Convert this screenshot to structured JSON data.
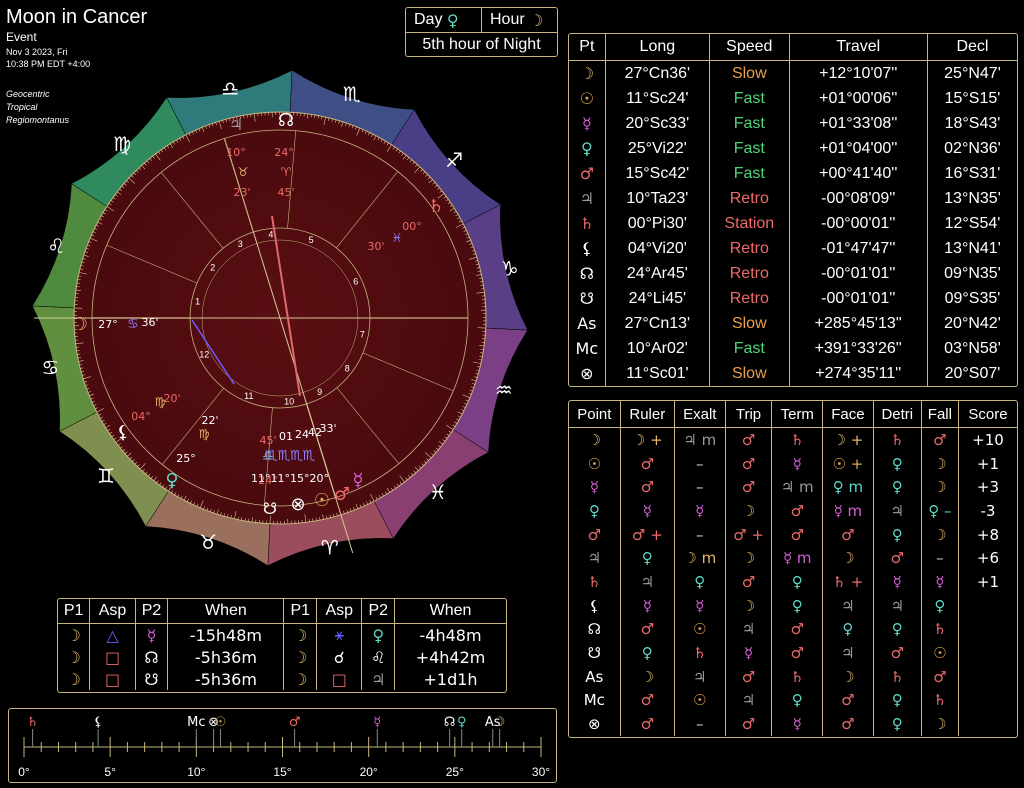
{
  "header": {
    "title": "Moon in Cancer",
    "subtitle": "Event",
    "date": "Nov 3 2023, Fri",
    "time": "10:38 PM EDT +4:00",
    "settings": [
      "Geocentric",
      "Tropical",
      "Regiomontanus"
    ]
  },
  "dayhour": {
    "day_label": "Day",
    "day_glyph": "♀",
    "hour_label": "Hour",
    "hour_glyph": "☽",
    "hour_text": "5th hour of Night"
  },
  "colors": {
    "moon": "#e9b76a",
    "sun": "#e0a64e",
    "mercury": "#d95fd8",
    "venus": "#5fd6c6",
    "mars": "#ef6a6a",
    "saturn": "#ef6a6a",
    "jupiter": "#9a9a9a",
    "fast": "#4fd37a",
    "slow": "#e9a04d",
    "retro": "#ef6a6a",
    "station": "#ef6a6a",
    "gold": "#c7b37f"
  },
  "planets": {
    "headers": [
      "Pt",
      "Long",
      "Speed",
      "Travel",
      "Decl"
    ],
    "rows": [
      {
        "g": "☽",
        "c": "#e9b76a",
        "long": "27°Cn36'",
        "speed": "Slow",
        "sc": "#e9a04d",
        "travel": "+12°10'07''",
        "decl": "25°N47'"
      },
      {
        "g": "☉",
        "c": "#e0a64e",
        "long": "11°Sc24'",
        "speed": "Fast",
        "sc": "#4fd37a",
        "travel": "+01°00'06''",
        "decl": "15°S15'"
      },
      {
        "g": "☿",
        "c": "#d95fd8",
        "long": "20°Sc33'",
        "speed": "Fast",
        "sc": "#4fd37a",
        "travel": "+01°33'08''",
        "decl": "18°S43'"
      },
      {
        "g": "♀",
        "c": "#5fd6c6",
        "long": "25°Vi22'",
        "speed": "Fast",
        "sc": "#4fd37a",
        "travel": "+01°04'00''",
        "decl": "02°N36'"
      },
      {
        "g": "♂",
        "c": "#ef6a6a",
        "long": "15°Sc42'",
        "speed": "Fast",
        "sc": "#4fd37a",
        "travel": "+00°41'40''",
        "decl": "16°S31'"
      },
      {
        "g": "♃",
        "c": "#9a9a9a",
        "long": "10°Ta23'",
        "speed": "Retro",
        "sc": "#ef6a6a",
        "travel": "-00°08'09''",
        "decl": "13°N35'"
      },
      {
        "g": "♄",
        "c": "#ef6a6a",
        "long": "00°Pi30'",
        "speed": "Station",
        "sc": "#ef6a6a",
        "travel": "-00°00'01''",
        "decl": "12°S54'"
      },
      {
        "g": "⚸",
        "c": "#ffffff",
        "long": "04°Vi20'",
        "speed": "Retro",
        "sc": "#ef6a6a",
        "travel": "-01°47'47''",
        "decl": "13°N41'"
      },
      {
        "g": "☊",
        "c": "#ffffff",
        "long": "24°Ar45'",
        "speed": "Retro",
        "sc": "#ef6a6a",
        "travel": "-00°01'01''",
        "decl": "09°N35'"
      },
      {
        "g": "☋",
        "c": "#ffffff",
        "long": "24°Li45'",
        "speed": "Retro",
        "sc": "#ef6a6a",
        "travel": "-00°01'01''",
        "decl": "09°S35'"
      },
      {
        "g": "As",
        "c": "#ffffff",
        "long": "27°Cn13'",
        "speed": "Slow",
        "sc": "#e9a04d",
        "travel": "+285°45'13''",
        "decl": "20°N42'"
      },
      {
        "g": "Mc",
        "c": "#ffffff",
        "long": "10°Ar02'",
        "speed": "Fast",
        "sc": "#4fd37a",
        "travel": "+391°33'26''",
        "decl": "03°N58'"
      },
      {
        "g": "⊗",
        "c": "#ffffff",
        "long": "11°Sc01'",
        "speed": "Slow",
        "sc": "#e9a04d",
        "travel": "+274°35'11''",
        "decl": "20°S07'"
      }
    ]
  },
  "dignities": {
    "headers": [
      "Point",
      "Ruler",
      "Exalt",
      "Trip",
      "Term",
      "Face",
      "Detri",
      "Fall",
      "Score"
    ],
    "rows": [
      [
        [
          "☽",
          "#e9b76a"
        ],
        [
          "☽ +",
          "#e9b76a"
        ],
        [
          "♃ m",
          "#9a9a9a"
        ],
        [
          "♂",
          "#ef6a6a"
        ],
        [
          "♄",
          "#ef6a6a"
        ],
        [
          "☽ +",
          "#e9b76a"
        ],
        [
          "♄",
          "#ef6a6a"
        ],
        [
          "♂",
          "#ef6a6a"
        ],
        [
          "+10",
          "#ffffff"
        ]
      ],
      [
        [
          "☉",
          "#e0a64e"
        ],
        [
          "♂",
          "#ef6a6a"
        ],
        [
          "–",
          "#cccccc"
        ],
        [
          "♂",
          "#ef6a6a"
        ],
        [
          "☿",
          "#d95fd8"
        ],
        [
          "☉ +",
          "#e0a64e"
        ],
        [
          "♀",
          "#5fd6c6"
        ],
        [
          "☽",
          "#e9b76a"
        ],
        [
          "+1",
          "#ffffff"
        ]
      ],
      [
        [
          "☿",
          "#d95fd8"
        ],
        [
          "♂",
          "#ef6a6a"
        ],
        [
          "–",
          "#cccccc"
        ],
        [
          "♂",
          "#ef6a6a"
        ],
        [
          "♃ m",
          "#9a9a9a"
        ],
        [
          "♀ m",
          "#5fd6c6"
        ],
        [
          "♀",
          "#5fd6c6"
        ],
        [
          "☽",
          "#e9b76a"
        ],
        [
          "+3",
          "#ffffff"
        ]
      ],
      [
        [
          "♀",
          "#5fd6c6"
        ],
        [
          "☿",
          "#d95fd8"
        ],
        [
          "☿",
          "#d95fd8"
        ],
        [
          "☽",
          "#e9b76a"
        ],
        [
          "♂",
          "#ef6a6a"
        ],
        [
          "☿ m",
          "#d95fd8"
        ],
        [
          "♃",
          "#9a9a9a"
        ],
        [
          "♀ –",
          "#5fd6c6"
        ],
        [
          "-3",
          "#ffffff"
        ]
      ],
      [
        [
          "♂",
          "#ef6a6a"
        ],
        [
          "♂ +",
          "#ef6a6a"
        ],
        [
          "–",
          "#cccccc"
        ],
        [
          "♂ +",
          "#ef6a6a"
        ],
        [
          "♂",
          "#ef6a6a"
        ],
        [
          "♂",
          "#ef6a6a"
        ],
        [
          "♀",
          "#5fd6c6"
        ],
        [
          "☽",
          "#e9b76a"
        ],
        [
          "+8",
          "#ffffff"
        ]
      ],
      [
        [
          "♃",
          "#9a9a9a"
        ],
        [
          "♀",
          "#5fd6c6"
        ],
        [
          "☽ m",
          "#e9b76a"
        ],
        [
          "☽",
          "#e9b76a"
        ],
        [
          "☿ m",
          "#d95fd8"
        ],
        [
          "☽",
          "#e9b76a"
        ],
        [
          "♂",
          "#ef6a6a"
        ],
        [
          "–",
          "#cccccc"
        ],
        [
          "+6",
          "#ffffff"
        ]
      ],
      [
        [
          "♄",
          "#ef6a6a"
        ],
        [
          "♃",
          "#9a9a9a"
        ],
        [
          "♀",
          "#5fd6c6"
        ],
        [
          "♂",
          "#ef6a6a"
        ],
        [
          "♀",
          "#5fd6c6"
        ],
        [
          "♄ +",
          "#ef6a6a"
        ],
        [
          "☿",
          "#d95fd8"
        ],
        [
          "☿",
          "#d95fd8"
        ],
        [
          "+1",
          "#ffffff"
        ]
      ],
      [
        [
          "⚸",
          "#ffffff"
        ],
        [
          "☿",
          "#d95fd8"
        ],
        [
          "☿",
          "#d95fd8"
        ],
        [
          "☽",
          "#e9b76a"
        ],
        [
          "♀",
          "#5fd6c6"
        ],
        [
          "♃",
          "#9a9a9a"
        ],
        [
          "♃",
          "#9a9a9a"
        ],
        [
          "♀",
          "#5fd6c6"
        ],
        [
          "",
          "#ffffff"
        ]
      ],
      [
        [
          "☊",
          "#ffffff"
        ],
        [
          "♂",
          "#ef6a6a"
        ],
        [
          "☉",
          "#e0a64e"
        ],
        [
          "♃",
          "#9a9a9a"
        ],
        [
          "♂",
          "#ef6a6a"
        ],
        [
          "♀",
          "#5fd6c6"
        ],
        [
          "♀",
          "#5fd6c6"
        ],
        [
          "♄",
          "#ef6a6a"
        ],
        [
          "",
          "#ffffff"
        ]
      ],
      [
        [
          "☋",
          "#ffffff"
        ],
        [
          "♀",
          "#5fd6c6"
        ],
        [
          "♄",
          "#ef6a6a"
        ],
        [
          "☿",
          "#d95fd8"
        ],
        [
          "♂",
          "#ef6a6a"
        ],
        [
          "♃",
          "#9a9a9a"
        ],
        [
          "♂",
          "#ef6a6a"
        ],
        [
          "☉",
          "#e0a64e"
        ],
        [
          "",
          "#ffffff"
        ]
      ],
      [
        [
          "As",
          "#ffffff"
        ],
        [
          "☽",
          "#e9b76a"
        ],
        [
          "♃",
          "#9a9a9a"
        ],
        [
          "♂",
          "#ef6a6a"
        ],
        [
          "♄",
          "#ef6a6a"
        ],
        [
          "☽",
          "#e9b76a"
        ],
        [
          "♄",
          "#ef6a6a"
        ],
        [
          "♂",
          "#ef6a6a"
        ],
        [
          "",
          "#ffffff"
        ]
      ],
      [
        [
          "Mc",
          "#ffffff"
        ],
        [
          "♂",
          "#ef6a6a"
        ],
        [
          "☉",
          "#e0a64e"
        ],
        [
          "♃",
          "#9a9a9a"
        ],
        [
          "♀",
          "#5fd6c6"
        ],
        [
          "♂",
          "#ef6a6a"
        ],
        [
          "♀",
          "#5fd6c6"
        ],
        [
          "♄",
          "#ef6a6a"
        ],
        [
          "",
          "#ffffff"
        ]
      ],
      [
        [
          "⊗",
          "#ffffff"
        ],
        [
          "♂",
          "#ef6a6a"
        ],
        [
          "–",
          "#cccccc"
        ],
        [
          "♂",
          "#ef6a6a"
        ],
        [
          "☿",
          "#d95fd8"
        ],
        [
          "♂",
          "#ef6a6a"
        ],
        [
          "♀",
          "#5fd6c6"
        ],
        [
          "☽",
          "#e9b76a"
        ],
        [
          "",
          "#ffffff"
        ]
      ]
    ]
  },
  "aspects": {
    "headers": [
      "P1",
      "Asp",
      "P2",
      "When",
      "P1",
      "Asp",
      "P2",
      "When"
    ],
    "rows": [
      [
        [
          "☽",
          "#e9b76a"
        ],
        [
          "△",
          "#6a5cff"
        ],
        [
          "☿",
          "#d95fd8"
        ],
        [
          "-15h48m",
          "#ffffff"
        ],
        [
          "☽",
          "#e9b76a"
        ],
        [
          "⚹",
          "#6a5cff"
        ],
        [
          "♀",
          "#5fd6c6"
        ],
        [
          "-4h48m",
          "#ffffff"
        ]
      ],
      [
        [
          "☽",
          "#e9b76a"
        ],
        [
          "□",
          "#ef6a6a"
        ],
        [
          "☊",
          "#ffffff"
        ],
        [
          "-5h36m",
          "#ffffff"
        ],
        [
          "☽",
          "#e9b76a"
        ],
        [
          "☌",
          "#ffffff"
        ],
        [
          "♌",
          "#ffffff"
        ],
        [
          "+4h42m",
          "#ffffff"
        ]
      ],
      [
        [
          "☽",
          "#e9b76a"
        ],
        [
          "□",
          "#ef6a6a"
        ],
        [
          "☋",
          "#ffffff"
        ],
        [
          "-5h36m",
          "#ffffff"
        ],
        [
          "☽",
          "#e9b76a"
        ],
        [
          "□",
          "#ef6a6a"
        ],
        [
          "♃",
          "#9a9a9a"
        ],
        [
          "+1d1h",
          "#ffffff"
        ]
      ]
    ]
  },
  "timeline": {
    "ticks": [
      "0°",
      "5°",
      "10°",
      "15°",
      "20°",
      "25°",
      "30°"
    ],
    "points": [
      {
        "g": "♄",
        "c": "#ef6a6a",
        "deg": 0.5
      },
      {
        "g": "⚸",
        "c": "#ffffff",
        "deg": 4.3
      },
      {
        "g": "Mc",
        "c": "#ffffff",
        "deg": 10.0
      },
      {
        "g": "⊗",
        "c": "#ffffff",
        "deg": 11.0
      },
      {
        "g": "☉",
        "c": "#e0a64e",
        "deg": 11.4
      },
      {
        "g": "♂",
        "c": "#ef6a6a",
        "deg": 15.7
      },
      {
        "g": "☿",
        "c": "#d95fd8",
        "deg": 20.5
      },
      {
        "g": "☊",
        "c": "#ffffff",
        "deg": 24.7
      },
      {
        "g": "♀",
        "c": "#5fd6c6",
        "deg": 25.4
      },
      {
        "g": "As",
        "c": "#ffffff",
        "deg": 27.2
      },
      {
        "g": "☽",
        "c": "#e9b76a",
        "deg": 27.6
      }
    ]
  },
  "wheel": {
    "signs": [
      {
        "g": "♉",
        "c": "#9b6f5e"
      },
      {
        "g": "♈",
        "c": "#9b4d5e"
      },
      {
        "g": "♓",
        "c": "#8a3f73"
      },
      {
        "g": "♒",
        "c": "#7b3f86"
      },
      {
        "g": "♑",
        "c": "#5b3f86"
      },
      {
        "g": "♐",
        "c": "#4a3f86"
      },
      {
        "g": "♏",
        "c": "#3f4f86"
      },
      {
        "g": "♎",
        "c": "#2f7a7a"
      },
      {
        "g": "♍",
        "c": "#2f8a5e"
      },
      {
        "g": "♌",
        "c": "#4f8a3f"
      },
      {
        "g": "♋",
        "c": "#5f8f3f"
      },
      {
        "g": "♊",
        "c": "#7f8f4f"
      }
    ],
    "houses": [
      "1",
      "2",
      "3",
      "4",
      "5",
      "6",
      "7",
      "8",
      "9",
      "10",
      "11",
      "12"
    ],
    "chart_labels": [
      {
        "t": "♃",
        "c": "#9a9a9a"
      },
      {
        "t": "☊",
        "c": "#ffffff"
      },
      {
        "t": "10°",
        "c": "#ef6a6a"
      },
      {
        "t": "24°",
        "c": "#ef6a6a"
      },
      {
        "t": "♉",
        "c": "#e9b76a"
      },
      {
        "t": "♈",
        "c": "#ef6a6a"
      },
      {
        "t": "23'",
        "c": "#ef6a6a"
      },
      {
        "t": "45'",
        "c": "#ef6a6a"
      },
      {
        "t": "♄",
        "c": "#ef6a6a"
      },
      {
        "t": "00°",
        "c": "#ef6a6a"
      },
      {
        "t": "♓",
        "c": "#8a7fff"
      },
      {
        "t": "30'",
        "c": "#ef6a6a"
      },
      {
        "t": "☽",
        "c": "#e9b76a"
      },
      {
        "t": "27°",
        "c": "#ffffff"
      },
      {
        "t": "♋",
        "c": "#8a7fff"
      },
      {
        "t": "36'",
        "c": "#ffffff"
      },
      {
        "t": "⚸",
        "c": "#ffffff"
      },
      {
        "t": "04°",
        "c": "#ef6a6a"
      },
      {
        "t": "♍",
        "c": "#e9b76a"
      },
      {
        "t": "20'",
        "c": "#ef6a6a"
      },
      {
        "t": "♀",
        "c": "#5fd6c6"
      },
      {
        "t": "25°",
        "c": "#ffffff"
      },
      {
        "t": "♍",
        "c": "#e9b76a"
      },
      {
        "t": "22'",
        "c": "#ffffff"
      },
      {
        "t": "45'",
        "c": "#ef6a6a"
      },
      {
        "t": "♎",
        "c": "#5fd6c6"
      },
      {
        "t": "24°",
        "c": "#ef6a6a"
      },
      {
        "t": "☋",
        "c": "#ffffff"
      },
      {
        "t": "01",
        "c": "#ffffff"
      },
      {
        "t": "24",
        "c": "#ffffff"
      },
      {
        "t": "42",
        "c": "#ffffff"
      },
      {
        "t": "33'",
        "c": "#ffffff"
      },
      {
        "t": "♏♏♏♏",
        "c": "#8a7fff"
      },
      {
        "t": "11°11°15°20°",
        "c": "#ffffff"
      },
      {
        "t": "⊗",
        "c": "#ffffff"
      },
      {
        "t": "☉",
        "c": "#e0a64e"
      },
      {
        "t": "♂",
        "c": "#ef6a6a"
      },
      {
        "t": "☿",
        "c": "#d95fd8"
      }
    ]
  }
}
